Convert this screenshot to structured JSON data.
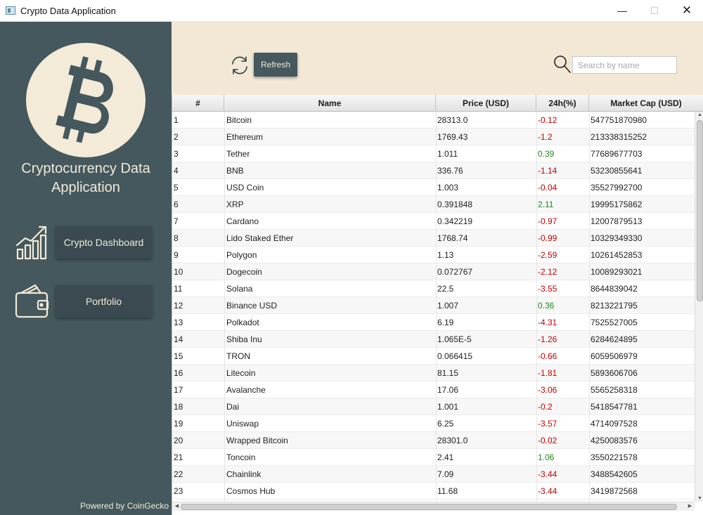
{
  "window": {
    "title": "Crypto Data Application"
  },
  "sidebar": {
    "app_name_line1": "Cryptocurrency Data",
    "app_name_line2": "Application",
    "nav": [
      {
        "label": "Crypto Dashboard",
        "icon": "chart-icon"
      },
      {
        "label": "Portfolio",
        "icon": "wallet-icon"
      }
    ],
    "powered_by": "Powered by CoinGecko"
  },
  "toolbar": {
    "refresh_label": "Refresh",
    "search_placeholder": "Search by name",
    "search_value": ""
  },
  "colors": {
    "sidebar": "#44585d",
    "accent_bg": "#f3e8d6",
    "negative": "#c40000",
    "positive": "#1d8a1d"
  },
  "table": {
    "columns": [
      "#",
      "Name",
      "Price (USD)",
      "24h(%)",
      "Market Cap (USD)"
    ],
    "rows": [
      [
        "1",
        "Bitcoin",
        "28313.0",
        "-0.12",
        "547751870980"
      ],
      [
        "2",
        "Ethereum",
        "1769.43",
        "-1.2",
        "213338315252"
      ],
      [
        "3",
        "Tether",
        "1.011",
        "0.39",
        "77689677703"
      ],
      [
        "4",
        "BNB",
        "336.76",
        "-1.14",
        "53230855641"
      ],
      [
        "5",
        "USD Coin",
        "1.003",
        "-0.04",
        "35527992700"
      ],
      [
        "6",
        "XRP",
        "0.391848",
        "2.11",
        "19995175862"
      ],
      [
        "7",
        "Cardano",
        "0.342219",
        "-0.97",
        "12007879513"
      ],
      [
        "8",
        "Lido Staked Ether",
        "1768.74",
        "-0.99",
        "10329349330"
      ],
      [
        "9",
        "Polygon",
        "1.13",
        "-2.59",
        "10261452853"
      ],
      [
        "10",
        "Dogecoin",
        "0.072767",
        "-2.12",
        "10089293021"
      ],
      [
        "11",
        "Solana",
        "22.5",
        "-3.55",
        "8644839042"
      ],
      [
        "12",
        "Binance USD",
        "1.007",
        "0.36",
        "8213221795"
      ],
      [
        "13",
        "Polkadot",
        "6.19",
        "-4.31",
        "7525527005"
      ],
      [
        "14",
        "Shiba Inu",
        "1.065E-5",
        "-1.26",
        "6284624895"
      ],
      [
        "15",
        "TRON",
        "0.066415",
        "-0.66",
        "6059506979"
      ],
      [
        "16",
        "Litecoin",
        "81.15",
        "-1.81",
        "5893606706"
      ],
      [
        "17",
        "Avalanche",
        "17.06",
        "-3.06",
        "5565258318"
      ],
      [
        "18",
        "Dai",
        "1.001",
        "-0.2",
        "5418547781"
      ],
      [
        "19",
        "Uniswap",
        "6.25",
        "-3.57",
        "4714097528"
      ],
      [
        "20",
        "Wrapped Bitcoin",
        "28301.0",
        "-0.02",
        "4250083576"
      ],
      [
        "21",
        "Toncoin",
        "2.41",
        "1.06",
        "3550221578"
      ],
      [
        "22",
        "Chainlink",
        "7.09",
        "-3.44",
        "3488542605"
      ],
      [
        "23",
        "Cosmos Hub",
        "11.68",
        "-3.44",
        "3419872568"
      ]
    ]
  }
}
